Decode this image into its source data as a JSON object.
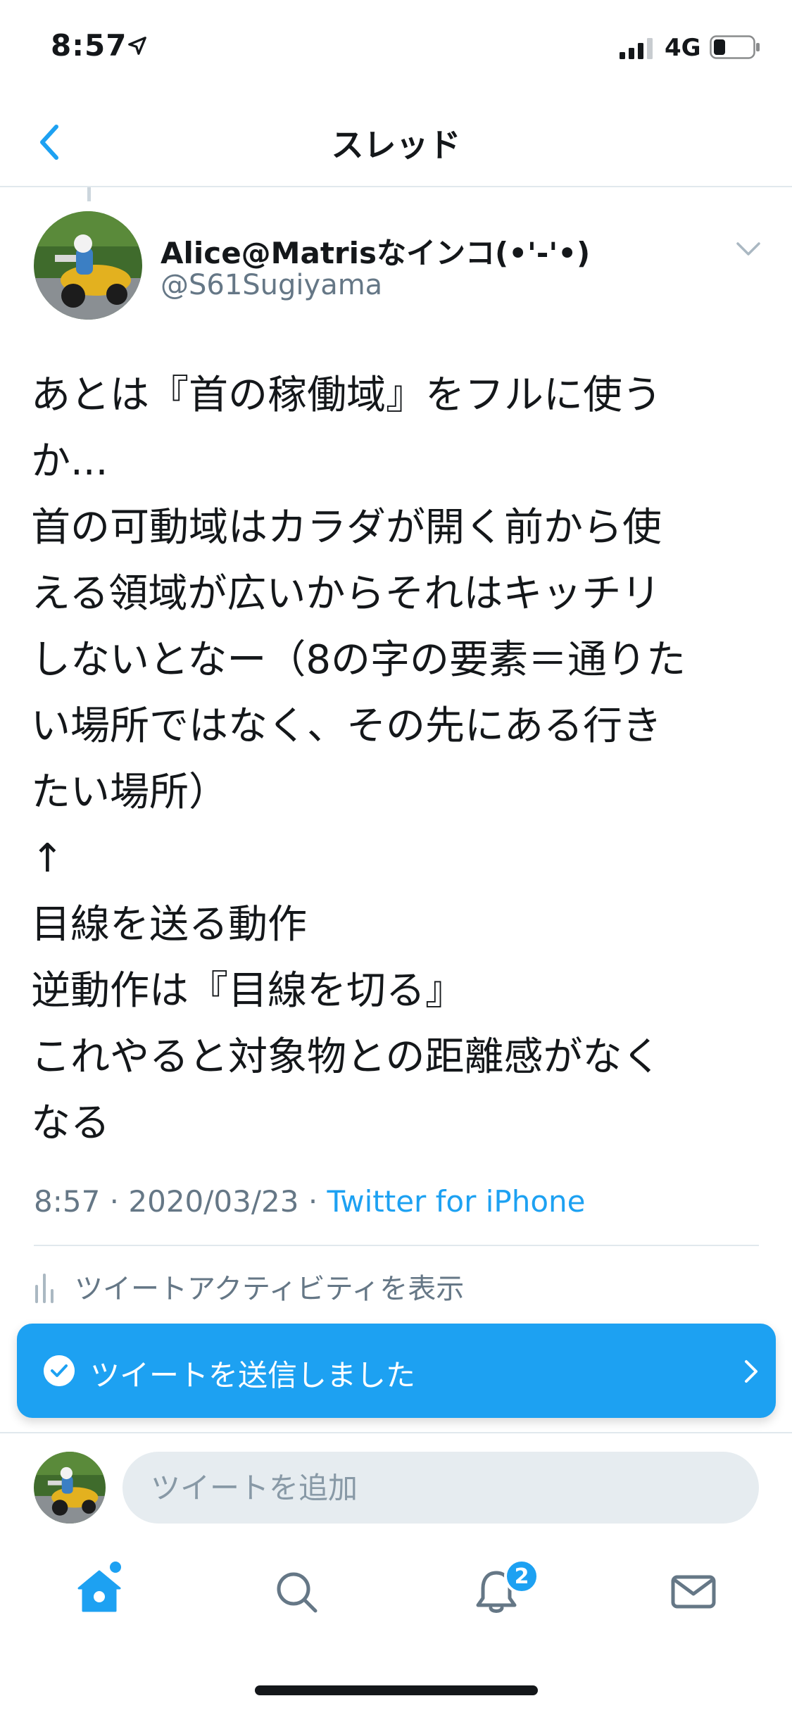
{
  "status_bar": {
    "time": "8:57",
    "network": "4G"
  },
  "header": {
    "title": "スレッド"
  },
  "tweet": {
    "display_name": "Alice@Matrisなインコ(•'-'•)",
    "handle": "@S61Sugiyama",
    "lines": [
      "あとは『首の稼働域』をフルに使う",
      "か...",
      "首の可動域はカラダが開く前から使",
      "える領域が広いからそれはキッチリ",
      "しないとなー（8の字の要素＝通りた",
      "い場所ではなく、その先にある行き",
      "たい場所）",
      "↑",
      "目線を送る動作",
      "逆動作は『目線を切る』",
      "これやると対象物との距離感がなく",
      "なる"
    ],
    "time": "8:57",
    "separator": " · ",
    "date": "2020/03/23",
    "source": "Twitter for iPhone",
    "activity_label": "ツイートアクティビティを表示"
  },
  "toast": {
    "text": "ツイートを送信しました"
  },
  "reply": {
    "placeholder": "ツイートを追加"
  },
  "tab_bar": {
    "notification_count": "2"
  },
  "colors": {
    "accent": "#1da1f2",
    "text": "#14171a",
    "secondary": "#657786",
    "divider": "#e1e8ed"
  }
}
